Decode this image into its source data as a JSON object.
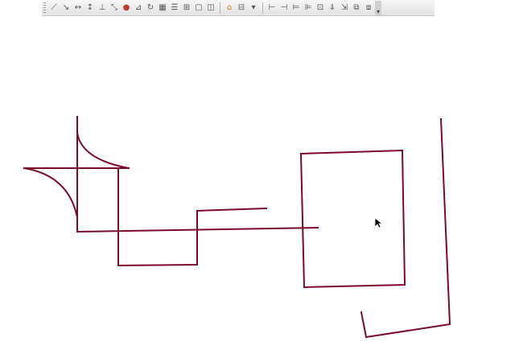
{
  "toolbar": {
    "groups": [
      {
        "buttons": [
          {
            "name": "draw-line-icon",
            "glyph": "⟋"
          },
          {
            "name": "dimension-icon",
            "glyph": "↘"
          },
          {
            "name": "horizontal-dimension-icon",
            "glyph": "↔"
          },
          {
            "name": "vertical-dimension-icon",
            "glyph": "↕"
          },
          {
            "name": "angled-dimension-icon",
            "glyph": "⊥"
          },
          {
            "name": "snap-icon",
            "glyph": "⤡"
          },
          {
            "name": "render-sphere-icon",
            "glyph": "●"
          },
          {
            "name": "measure-icon",
            "glyph": "⊿"
          },
          {
            "name": "refresh-icon",
            "glyph": "↻"
          },
          {
            "name": "grid-icon",
            "glyph": "▦"
          },
          {
            "name": "layers-icon",
            "glyph": "☰"
          },
          {
            "name": "table-icon",
            "glyph": "⊞"
          },
          {
            "name": "view-icon",
            "glyph": "▢"
          },
          {
            "name": "view-3d-icon",
            "glyph": "◫"
          }
        ]
      },
      {
        "buttons": [
          {
            "name": "home-view-icon",
            "glyph": "⌂"
          },
          {
            "name": "section-icon",
            "glyph": "⊟"
          },
          {
            "name": "dropdown-arrow-icon",
            "glyph": "▾"
          }
        ]
      },
      {
        "buttons": [
          {
            "name": "align-left-icon",
            "glyph": "⊢"
          },
          {
            "name": "align-right-icon",
            "glyph": "⊣"
          },
          {
            "name": "align-middle-icon",
            "glyph": "⊨"
          },
          {
            "name": "distribute-icon",
            "glyph": "⊫"
          },
          {
            "name": "frame-icon",
            "glyph": "⊡"
          },
          {
            "name": "move-down-icon",
            "glyph": "⇓"
          },
          {
            "name": "move-check-icon",
            "glyph": "⇲"
          },
          {
            "name": "copy-icon",
            "glyph": "⧉"
          },
          {
            "name": "paste-icon",
            "glyph": "⧈"
          }
        ]
      }
    ],
    "overflow_glyph": "▾"
  },
  "colors": {
    "stroke": "#7a0a2a",
    "toolbar_bg": "#e8e8e8"
  }
}
